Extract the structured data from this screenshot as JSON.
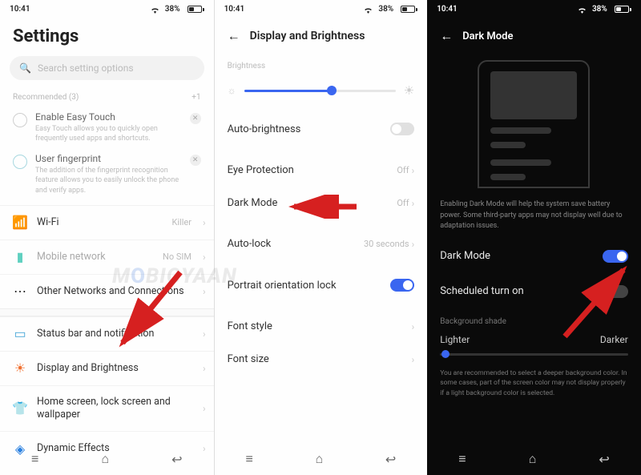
{
  "status": {
    "time": "10:41",
    "battery": "38%"
  },
  "panel1": {
    "title": "Settings",
    "search_placeholder": "Search setting options",
    "recommended_header": "Recommended (3)",
    "recommended_more": "+1",
    "recs": [
      {
        "title": "Enable Easy Touch",
        "sub": "Easy Touch allows you to quickly open frequently used apps and shortcuts."
      },
      {
        "title": "User fingerprint",
        "sub": "The addition of the fingerprint recognition feature allows you to easily unlock the phone and verify apps."
      }
    ],
    "items1": [
      {
        "label": "Wi-Fi",
        "value": "Killer",
        "icon": "wifi"
      },
      {
        "label": "Mobile network",
        "value": "No SIM",
        "icon": "sim"
      },
      {
        "label": "Other Networks and Connections",
        "value": "",
        "icon": "dots"
      }
    ],
    "items2": [
      {
        "label": "Status bar and notification",
        "icon": "statusbar"
      },
      {
        "label": "Display and Brightness",
        "icon": "brightness"
      },
      {
        "label": "Home screen, lock screen and wallpaper",
        "icon": "wallpaper"
      },
      {
        "label": "Dynamic Effects",
        "icon": "dynamic"
      }
    ]
  },
  "panel2": {
    "title": "Display and Brightness",
    "brightness_label": "Brightness",
    "rows": {
      "auto_brightness": "Auto-brightness",
      "eye_protection": "Eye Protection",
      "eye_value": "Off",
      "dark_mode": "Dark Mode",
      "dark_value": "Off",
      "auto_lock": "Auto-lock",
      "auto_lock_value": "30 seconds",
      "portrait_lock": "Portrait orientation lock",
      "font_style": "Font style",
      "font_size": "Font size"
    }
  },
  "panel3": {
    "title": "Dark Mode",
    "desc": "Enabling Dark Mode will help the system save battery power. Some third-party apps may not display well due to adaptation issues.",
    "dark_mode": "Dark Mode",
    "scheduled": "Scheduled turn on",
    "shade_label": "Background shade",
    "lighter": "Lighter",
    "darker": "Darker",
    "note": "You are recommended to select a deeper background color. In some cases, part of the screen color may not display properly if a light background color is selected."
  },
  "watermark": {
    "a": "M",
    "b": "O",
    "c": "BIGYAAN"
  },
  "chevron": "›",
  "nav": {
    "menu": "≡",
    "home": "⌂",
    "back": "↩"
  }
}
